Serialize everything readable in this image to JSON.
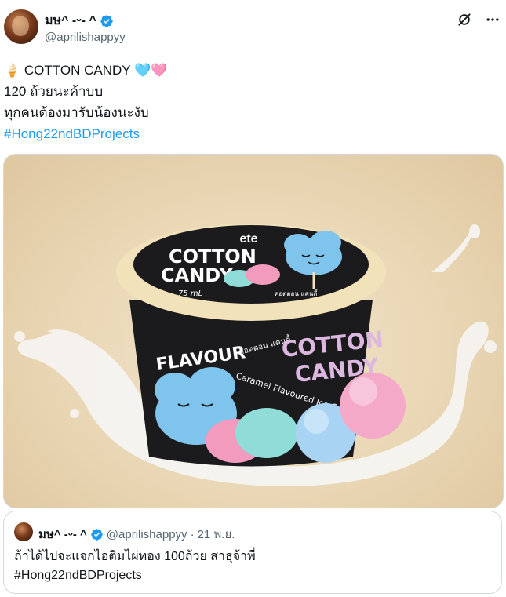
{
  "author": {
    "display_name": "มษ^ -ᵕ- ^",
    "handle": "@aprilishappyy"
  },
  "tweet": {
    "line1_emoji": "🍦",
    "line1_text": "COTTON CANDY",
    "line1_hearts": "🩵🩷",
    "line2": "120 ถ้วยนะค้าบบ",
    "line3": "ทุกคนต้องมารับน้องนะงับ",
    "hashtag": "#Hong22ndBDProjects"
  },
  "media": {
    "brand": "ete",
    "cup_title_1": "COTTON",
    "cup_title_2": "CANDY",
    "cup_volume": "75 mL",
    "cup_thai": "คอตตอน แคนดี้",
    "side_flavour": "FLAVOUR",
    "side_thai": "คอตตอน แคนดี้",
    "side_caramel": "Caramel Flavoured Ice Cream",
    "side_title_1": "COTTON",
    "side_title_2": "CANDY"
  },
  "quote": {
    "display_name": "มษ^ -ᵕ- ^",
    "handle": "@aprilishappyy",
    "dot": "·",
    "date": "21 พ.ย.",
    "text_line1": "ถ้าได้ไปจะแจกไอติมไผ่ทอง 100ถ้วย สาธุจ้าพี่",
    "hashtag": "#Hong22ndBDProjects"
  },
  "colors": {
    "link": "#1d9bf0",
    "verified": "#1d9bf0",
    "muted": "#536471",
    "cup_black": "#1b1b1d",
    "cup_lid": "#f2e2b9",
    "cloud_blue": "#7fc4ec",
    "cotton_pink": "#f29bbd"
  }
}
